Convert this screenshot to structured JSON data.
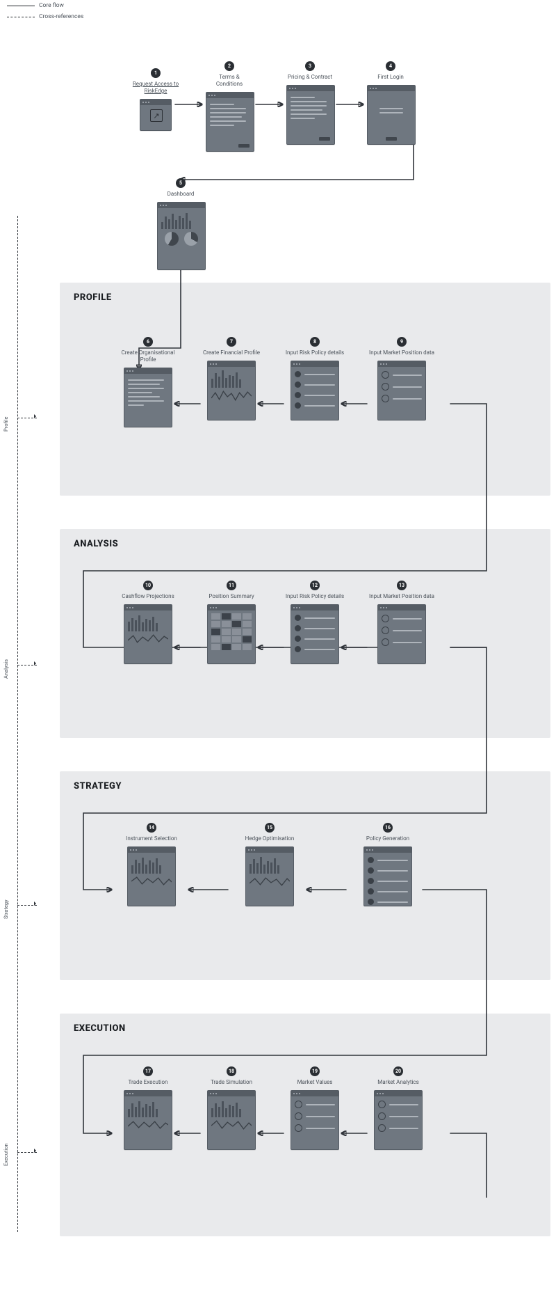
{
  "legend": {
    "solid": "Core flow",
    "dashed": "Cross-references"
  },
  "spine_labels": [
    "Profile",
    "Analysis",
    "Strategy",
    "Execution"
  ],
  "sections": {
    "profile": {
      "title": "PROFILE"
    },
    "analysis": {
      "title": "ANALYSIS"
    },
    "strategy": {
      "title": "STRATEGY"
    },
    "execution": {
      "title": "EXECUTION"
    }
  },
  "steps": {
    "1": {
      "num": "1",
      "label": "Request Access to RiskEdge"
    },
    "2": {
      "num": "2",
      "label": "Terms & Conditions"
    },
    "3": {
      "num": "3",
      "label": "Pricing & Contract"
    },
    "4": {
      "num": "4",
      "label": "First Login"
    },
    "5": {
      "num": "5",
      "label": "Dashboard"
    },
    "6": {
      "num": "6",
      "label": "Create Organisational Profile"
    },
    "7": {
      "num": "7",
      "label": "Create Financial Profile"
    },
    "8": {
      "num": "8",
      "label": "Input Risk Policy details"
    },
    "9": {
      "num": "9",
      "label": "Input Market Position data"
    },
    "10": {
      "num": "10",
      "label": "Cashflow Projections"
    },
    "11": {
      "num": "11",
      "label": "Position Summary"
    },
    "12": {
      "num": "12",
      "label": "Input Risk Policy details"
    },
    "13": {
      "num": "13",
      "label": "Input Market Position data"
    },
    "14": {
      "num": "14",
      "label": "Instrument Selection"
    },
    "15": {
      "num": "15",
      "label": "Hedge Optimisation"
    },
    "16": {
      "num": "16",
      "label": "Policy Generation"
    },
    "17": {
      "num": "17",
      "label": "Trade Execution"
    },
    "18": {
      "num": "18",
      "label": "Trade Simulation"
    },
    "19": {
      "num": "19",
      "label": "Market Values"
    },
    "20": {
      "num": "20",
      "label": "Market Analytics"
    }
  }
}
